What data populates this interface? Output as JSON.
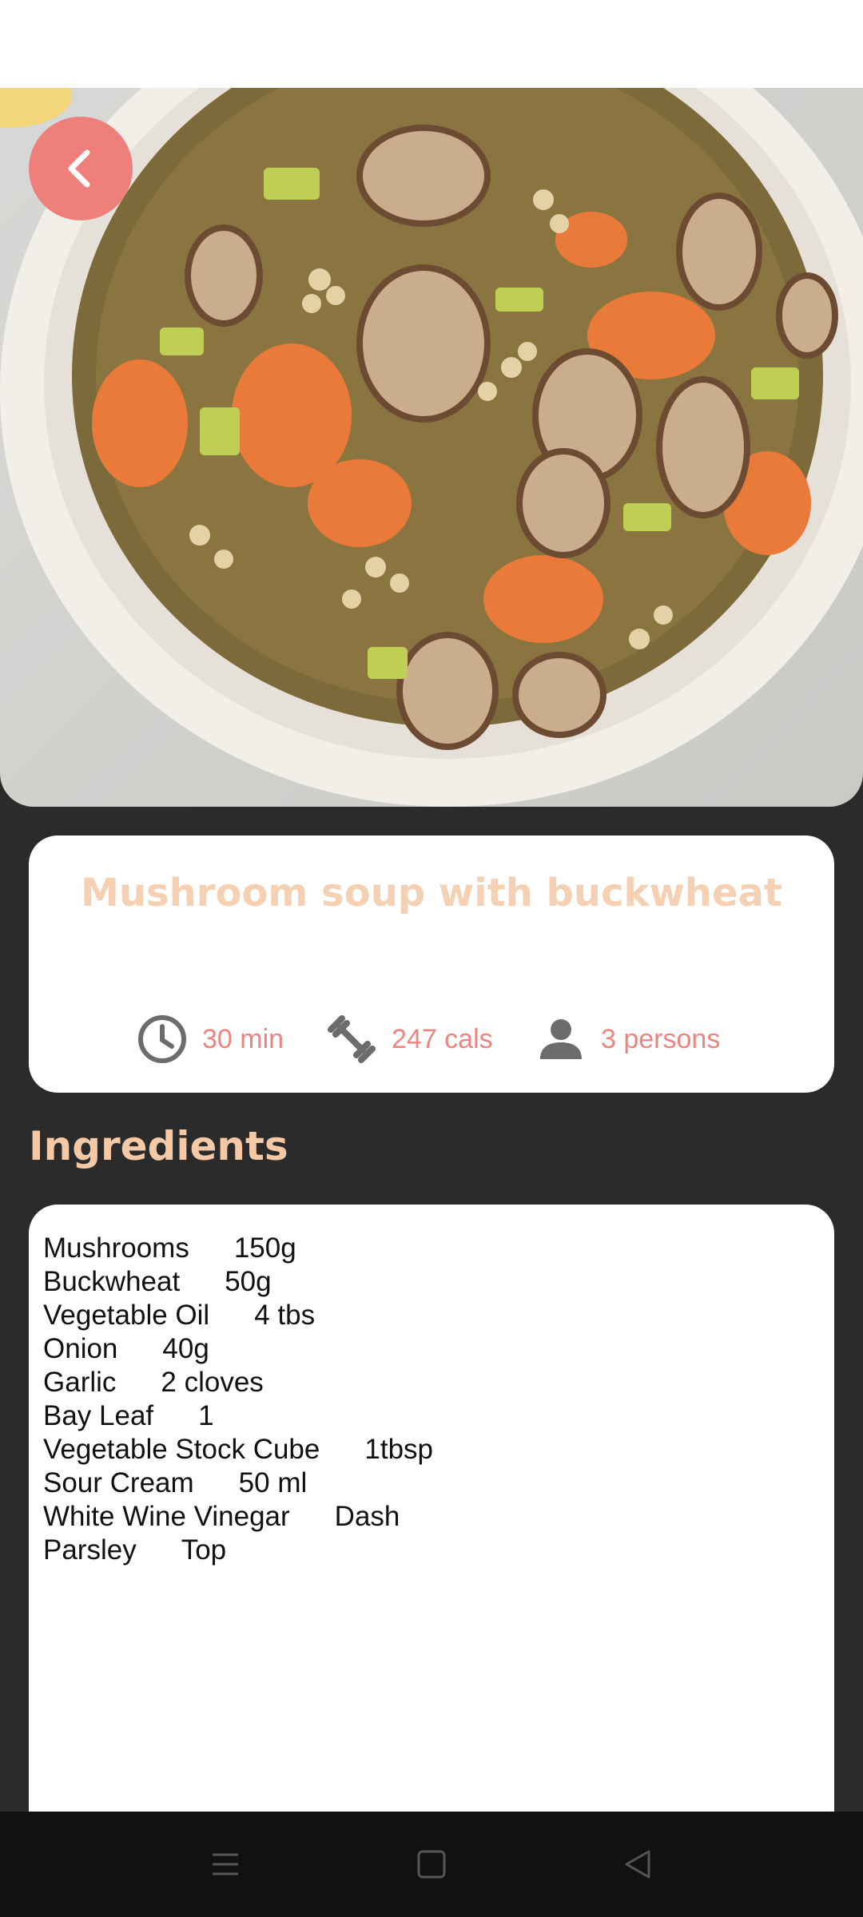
{
  "recipe": {
    "title": "Mushroom soup with buckwheat",
    "time": "30 min",
    "calories": "247 cals",
    "servings": "3 persons"
  },
  "icons": {
    "back": "chevron-left-icon",
    "time": "clock-icon",
    "calories": "dumbbell-icon",
    "servings": "person-icon"
  },
  "ingredients_heading": "Ingredients",
  "ingredients": [
    {
      "name": "Mushrooms",
      "qty": "150g"
    },
    {
      "name": "Buckwheat",
      "qty": "50g"
    },
    {
      "name": "Vegetable Oil",
      "qty": "4 tbs"
    },
    {
      "name": "Onion",
      "qty": "40g"
    },
    {
      "name": "Garlic",
      "qty": "2 cloves"
    },
    {
      "name": "Bay Leaf",
      "qty": "1"
    },
    {
      "name": "Vegetable Stock Cube",
      "qty": "1tbsp"
    },
    {
      "name": "Sour Cream",
      "qty": "50 ml"
    },
    {
      "name": "White Wine Vinegar",
      "qty": "Dash"
    },
    {
      "name": "Parsley",
      "qty": "Top"
    }
  ],
  "colors": {
    "accent": "#ee7f7a",
    "title": "#f6d0b3",
    "heading": "#f6c9a6",
    "background": "#2b2b2b"
  }
}
